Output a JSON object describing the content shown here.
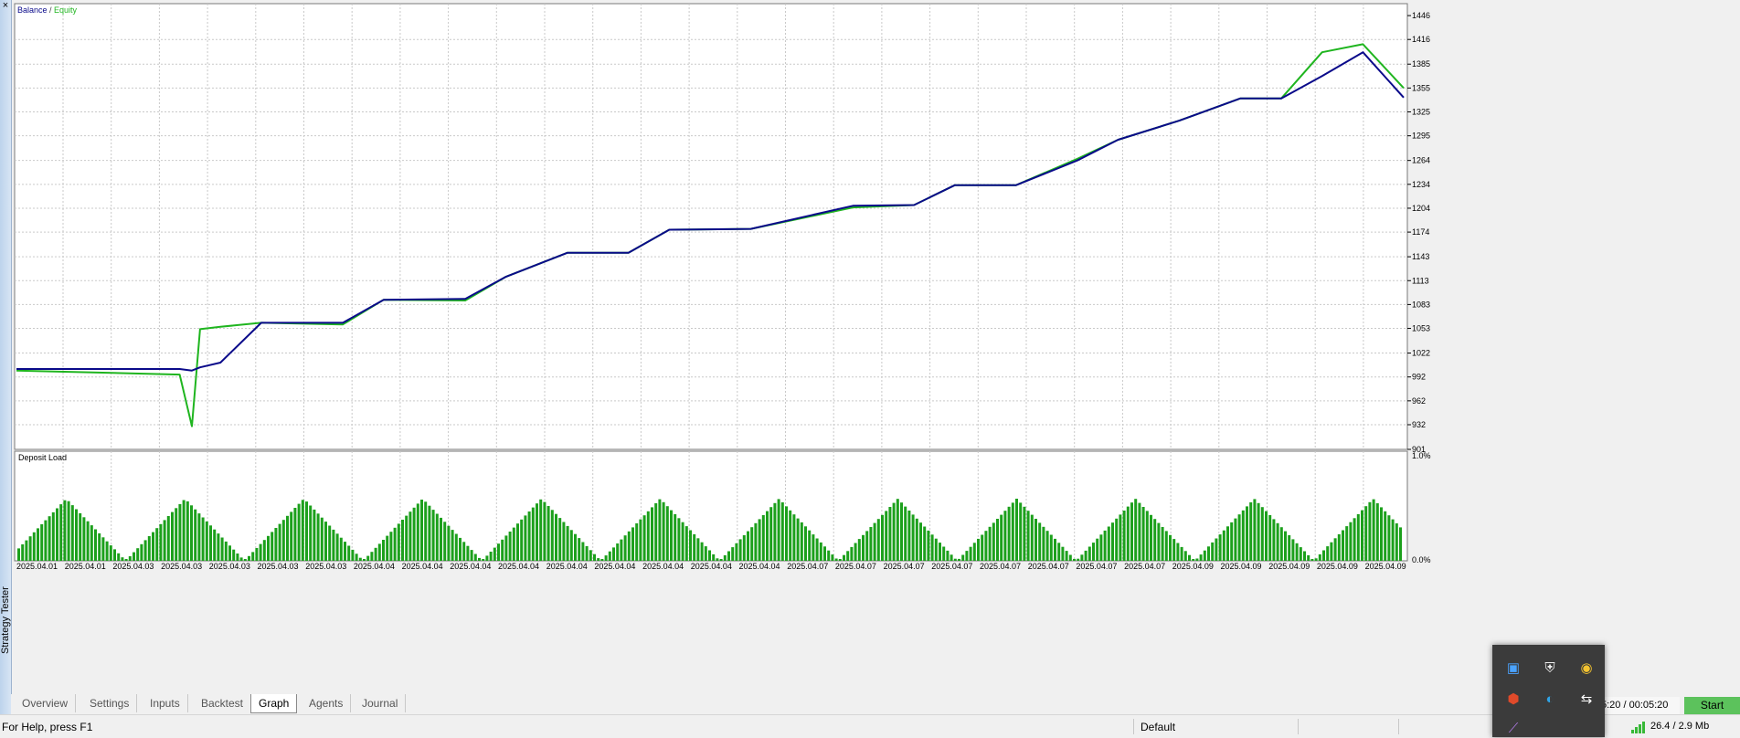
{
  "sidebar": {
    "title": "Strategy Tester",
    "close_glyph": "×"
  },
  "main_chart": {
    "legend": {
      "balance": "Balance",
      "separator": " / ",
      "equity": "Equity"
    },
    "colors": {
      "balance": "#0a0a8a",
      "equity": "#1fb51f",
      "grid": "#c9c9c9",
      "axis_text": "#000000"
    },
    "y_ticks": [
      "1446",
      "1416",
      "1385",
      "1355",
      "1325",
      "1295",
      "1264",
      "1234",
      "1204",
      "1174",
      "1143",
      "1113",
      "1083",
      "1053",
      "1022",
      "992",
      "962",
      "932",
      "901"
    ],
    "x_ticks": [
      "2025.04.01",
      "2025.04.01",
      "2025.04.03",
      "2025.04.03",
      "2025.04.03",
      "2025.04.03",
      "2025.04.03",
      "2025.04.04",
      "2025.04.04",
      "2025.04.04",
      "2025.04.04",
      "2025.04.04",
      "2025.04.04",
      "2025.04.04",
      "2025.04.04",
      "2025.04.04",
      "2025.04.07",
      "2025.04.07",
      "2025.04.07",
      "2025.04.07",
      "2025.04.07",
      "2025.04.07",
      "2025.04.07",
      "2025.04.07",
      "2025.04.09",
      "2025.04.09",
      "2025.04.09",
      "2025.04.09",
      "2025.04.09"
    ]
  },
  "chart_data": [
    {
      "type": "line",
      "title": "Balance / Equity",
      "ylim": [
        901,
        1461
      ],
      "grid": true,
      "legend_position": "top-left",
      "x": [
        0,
        4,
        4.3,
        4.5,
        5,
        6,
        8,
        9,
        11,
        12,
        13.5,
        15,
        16,
        18,
        20.5,
        22,
        23,
        24.5,
        26,
        27,
        28.5,
        30,
        31,
        32,
        33,
        34
      ],
      "series": [
        {
          "name": "Balance",
          "values": [
            1002,
            1002,
            1000,
            1004,
            1010,
            1060,
            1060,
            1089,
            1090,
            1118,
            1148,
            1148,
            1177,
            1178,
            1207,
            1208,
            1233,
            1233,
            1264,
            1290,
            1314,
            1342,
            1342,
            1370,
            1400,
            1343
          ]
        },
        {
          "name": "Equity",
          "values": [
            1000,
            995,
            930,
            1052,
            1055,
            1060,
            1058,
            1089,
            1088,
            1118,
            1148,
            1148,
            1177,
            1178,
            1205,
            1208,
            1233,
            1233,
            1266,
            1290,
            1314,
            1342,
            1342,
            1400,
            1410,
            1355
          ]
        }
      ]
    },
    {
      "type": "bar",
      "title": "Deposit Load",
      "ylim": [
        0,
        1.0
      ],
      "y_ticks": [
        "1.0%",
        "0.0%"
      ],
      "pattern": "rising-and-falling triangular cycles, peak ≈ 0.6%"
    }
  ],
  "deposit_chart": {
    "title": "Deposit Load",
    "y_top": "1.0%",
    "y_bottom": "0.0%",
    "bar_color": "#1ca01c"
  },
  "tabs": [
    {
      "label": "Overview",
      "active": false
    },
    {
      "label": "Settings",
      "active": false
    },
    {
      "label": "Inputs",
      "active": false
    },
    {
      "label": "Backtest",
      "active": false
    },
    {
      "label": "Graph",
      "active": true
    },
    {
      "label": "Agents",
      "active": false
    },
    {
      "label": "Journal",
      "active": false
    }
  ],
  "timer": "00:05:20 / 00:05:20",
  "start_label": "Start",
  "statusbar": {
    "help": "For Help, press F1",
    "profile": "Default",
    "connection": "26.4 / 2.9 Mb"
  },
  "tray_icons": [
    "monitor-icon",
    "shield-icon",
    "chrome-icon",
    "antivirus-icon",
    "edge-icon",
    "sync-icon",
    "feather-icon"
  ]
}
